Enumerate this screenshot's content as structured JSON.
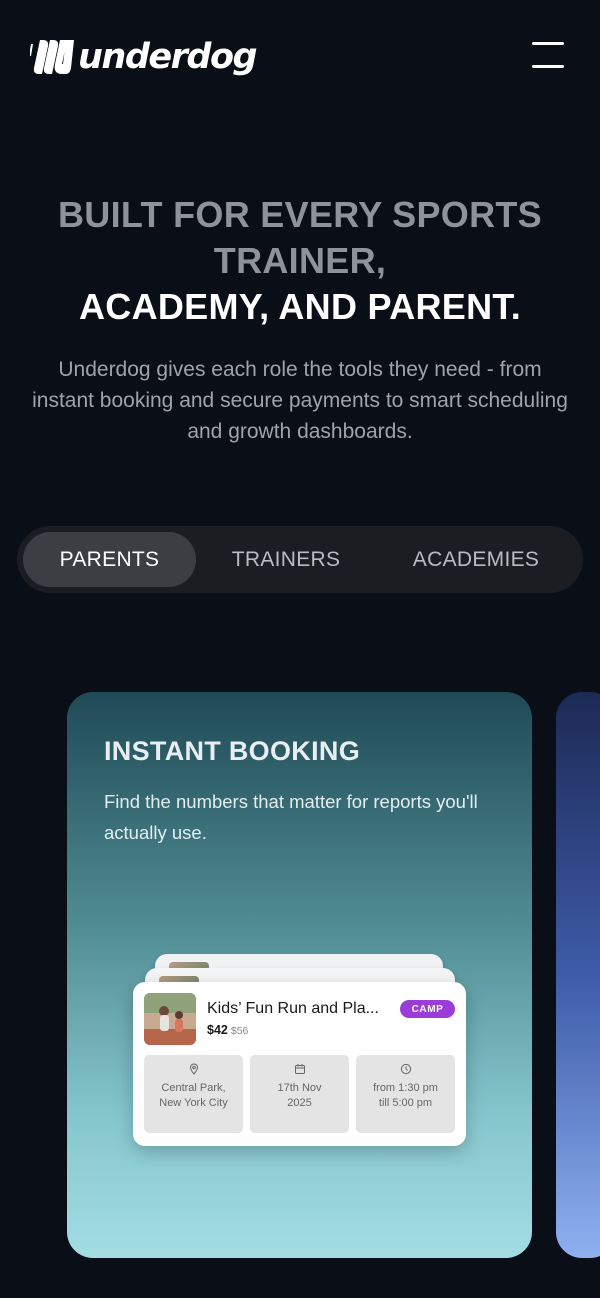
{
  "header": {
    "logo_text": "underdog",
    "menu_icon": "hamburger-menu-icon"
  },
  "hero": {
    "title_line1": "BUILT FOR EVERY SPORTS",
    "title_line2": "TRAINER,",
    "title_line3": "ACADEMY, AND PARENT.",
    "subtitle": "Underdog gives each role the tools they need - from instant booking and secure payments to smart scheduling and growth dashboards."
  },
  "tabs": [
    {
      "label": "PARENTS",
      "active": true
    },
    {
      "label": "TRAINERS",
      "active": false
    },
    {
      "label": "ACADEMIES",
      "active": false
    }
  ],
  "feature_card": {
    "title": "INSTANT BOOKING",
    "description": "Find the numbers that matter for reports you'll actually use."
  },
  "event": {
    "name": "Kids’ Fun Run and Pla...",
    "price": "$42",
    "old_price": "$56",
    "badge": "CAMP",
    "location": "Central Park, New York City",
    "date": "17th Nov 2025",
    "time": "from 1:30 pm till 5:00 pm"
  },
  "colors": {
    "background": "#0a0e17",
    "badge": "#9b3bd8",
    "card_gradient_top": "#1f4a55",
    "card_gradient_bottom": "#a3dde3"
  }
}
